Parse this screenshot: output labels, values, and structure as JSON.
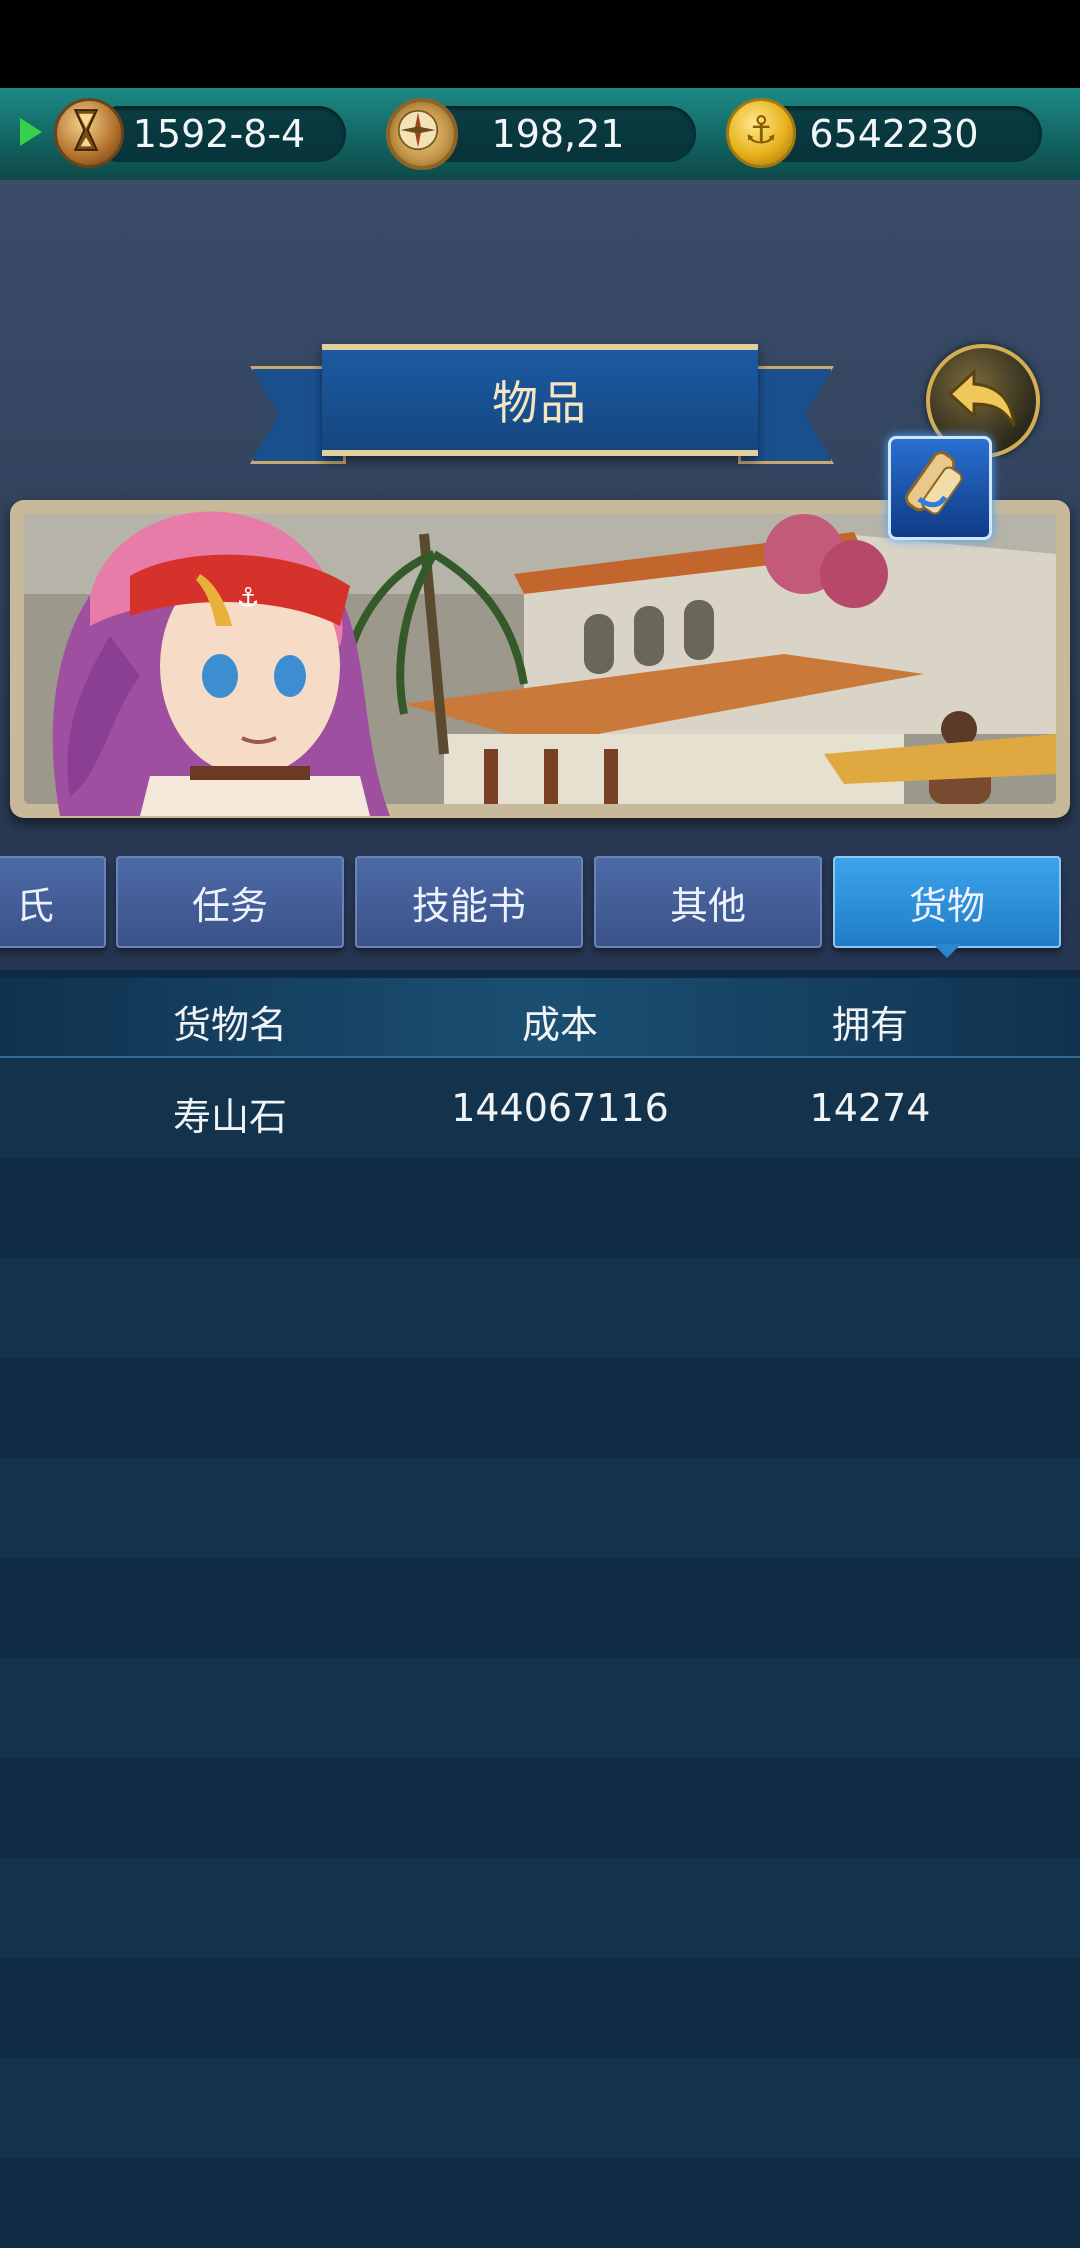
{
  "status_bar": {
    "date": "1592-8-4",
    "coordinates": "198,21",
    "gold": "6542230"
  },
  "title": "物品",
  "tabs": [
    {
      "label": "氏",
      "active": false
    },
    {
      "label": "任务",
      "active": false
    },
    {
      "label": "技能书",
      "active": false
    },
    {
      "label": "其他",
      "active": false
    },
    {
      "label": "货物",
      "active": true
    }
  ],
  "table": {
    "columns": [
      "货物名",
      "成本",
      "拥有"
    ],
    "rows": [
      {
        "name": "寿山石",
        "cost": "144067116",
        "owned": "14274"
      }
    ]
  },
  "icons": {
    "play": "play-icon",
    "date": "hourglass-icon",
    "coordinates": "compass-icon",
    "gold": "anchor-coin-icon",
    "back": "back-arrow-icon",
    "item": "scroll-icon"
  },
  "colors": {
    "accent_tab": "#2a8ad6",
    "tab": "#445e99",
    "table_bg": "#0f2b44"
  }
}
